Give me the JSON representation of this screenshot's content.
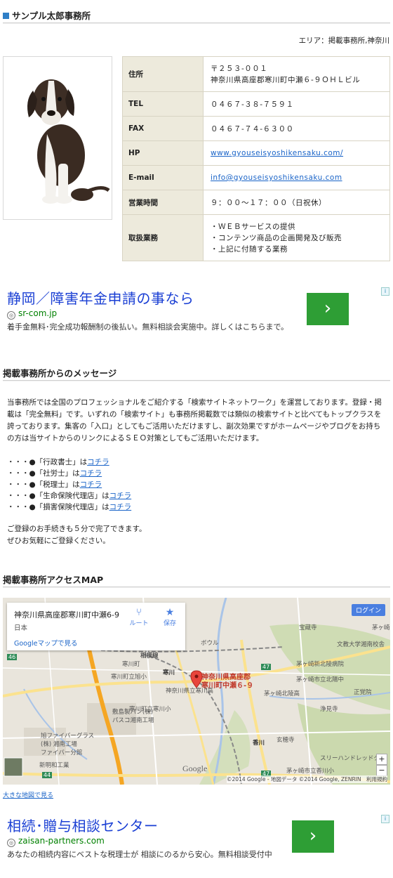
{
  "office": {
    "name": "サンプル太郎事務所",
    "area": "エリア：掲載事務所,神奈川",
    "photo_alt": "",
    "rows": [
      {
        "label": "住所",
        "lines": [
          "〒２５３-００１",
          "神奈川県高座郡寒川町中瀬６-９ＯＨＬビル"
        ]
      },
      {
        "label": "TEL",
        "lines": [
          "０４６７-３８-７５９１"
        ]
      },
      {
        "label": "FAX",
        "lines": [
          "０４６７-７４-６３００"
        ]
      },
      {
        "label": "HP",
        "link": "www.gyouseisyoshikensaku.com/"
      },
      {
        "label": "E-mail",
        "link": "info@gyouseisyoshikensaku.com"
      },
      {
        "label": "営業時間",
        "lines": [
          "９：００～１７：００（日祝休）"
        ]
      },
      {
        "label": "取扱業務",
        "lines": [
          "・ＷＥＢサービスの提供",
          "・コンテンツ商品の企画開発及び販売",
          "・上記に付随する業務"
        ]
      }
    ]
  },
  "ad1": {
    "headline": "静岡／障害年金申請の事なら",
    "url": "sr-com.jp",
    "desc": "着手金無料･完全成功報酬制の後払い。無料相談会実施中。詳しくはこちらまで。",
    "button": "›"
  },
  "message": {
    "title": "掲載事務所からのメッセージ",
    "intro": "当事務所では全国のプロフェッショナルをご紹介する「検索サイトネットワーク」を運営しております。登録・掲載は「完全無料」です。いずれの「検索サイト」も事務所掲載数では類似の検索サイトと比べてもトップクラスを誇っております。集客の「入口」としてもご活用いただけますし、副次効果ですがホームページやブログをお持ちの方は当サイトからのリンクによるＳＥＯ対策としてもご活用いただけます。",
    "items": [
      {
        "prefix": "・・・●「行政書士」は",
        "link": "コチラ"
      },
      {
        "prefix": "・・・●「社労士」は",
        "link": "コチラ"
      },
      {
        "prefix": "・・・●「税理士」は",
        "link": "コチラ"
      },
      {
        "prefix": "・・・●「生命保険代理店」は",
        "link": "コチラ"
      },
      {
        "prefix": "・・・●「損害保険代理店」は",
        "link": "コチラ"
      }
    ],
    "closing1": "ご登録のお手続きも５分で完了できます。",
    "closing2": "ぜひお気軽にご登録ください。"
  },
  "map": {
    "title": "掲載事務所アクセスMAP",
    "card_address": "神奈川県高座郡寒川町中瀬6-9",
    "card_country": "日本",
    "card_link": "Googleマップで見る",
    "route_label": "ルート",
    "save_label": "保存",
    "login": "ログイン",
    "marker_label_1": "神奈川県高座郡",
    "marker_label_2": "寒川町中瀬６-９",
    "places": [
      "宝蔵寺",
      "文教大学湘南校舎",
      "茅ヶ崎新北陵病院",
      "茅ヶ崎市立北陽中",
      "正覚院",
      "茅ヶ崎北陵高",
      "浄見寺",
      "玄穂寺",
      "スリーハンドレッドク",
      "茅ヶ崎市立香川小",
      "神奈川県立寒川高",
      "寒川町立寒川小",
      "寒川町立旭小",
      "寒川町",
      "寒川",
      "香川",
      "敷島製パン(株)",
      "パスコ湘南工場",
      "旭ファイバーグラス",
      "(株) 湘南工場",
      "ファイバー分館",
      "新明和工業",
      "相模線",
      "ボウル",
      "茅ヶ崎"
    ],
    "google": "Google",
    "copyright": "©2014 Google - 地図データ ©2014 Google, ZENRIN　利用規約",
    "road_numbers": [
      "47",
      "46",
      "44",
      "47"
    ],
    "large_map_link": "大きな地図で見る"
  },
  "ad2": {
    "headline": "相続･贈与相談センター",
    "url": "zaisan-partners.com",
    "desc": "あなたの相続内容にベストな税理士が 相談にのるから安心。無料相談受付中",
    "button": "›"
  },
  "colors": {
    "accent_blue": "#2f7fc7",
    "link": "#1a64c8",
    "ad_headline": "#1a3fd4",
    "ad_button": "#2e9e35",
    "th_bg": "#edeadc"
  }
}
